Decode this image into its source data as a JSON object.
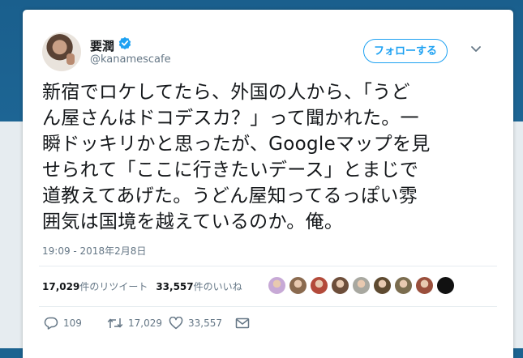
{
  "user": {
    "display_name": "要潤",
    "handle": "@kanamescafe"
  },
  "follow_button": "フォローする",
  "tweet": {
    "text": "新宿でロケしてたら、外国の人から、「うど\nん屋さんはドコデスカ？」って聞かれた。一\n瞬ドッキリかと思ったが、Googleマップを見\nせられて「ここに行きたいデース」とまじで\n道教えてあげた。うどん屋知ってるっぽい雰\n囲気は国境を越えているのか。俺。",
    "timestamp": "19:09 - 2018年2月8日"
  },
  "stats": {
    "retweets_count": "17,029",
    "retweets_label": "件のリツイート",
    "likes_count": "33,557",
    "likes_label": "件のいいね"
  },
  "likers": [
    {
      "icon": "liker-avatar-1",
      "color": "#c7a9d6"
    },
    {
      "icon": "liker-avatar-2",
      "color": "#8a6a4f"
    },
    {
      "icon": "liker-avatar-3",
      "color": "#b34a3a"
    },
    {
      "icon": "liker-avatar-4",
      "color": "#6d4e3a"
    },
    {
      "icon": "liker-avatar-5",
      "color": "#a8a8a0"
    },
    {
      "icon": "liker-avatar-6",
      "color": "#5e4a30"
    },
    {
      "icon": "liker-avatar-7",
      "color": "#7b6d4f"
    },
    {
      "icon": "liker-avatar-8",
      "color": "#9a4f3c"
    },
    {
      "icon": "liker-avatar-9",
      "color": "#111111"
    }
  ],
  "actions": {
    "reply_count": "109",
    "retweet_count": "17,029",
    "like_count": "33,557"
  },
  "colors": {
    "accent": "#1da1f2",
    "secondary_text": "#657786",
    "background_top": "#1c6390"
  }
}
